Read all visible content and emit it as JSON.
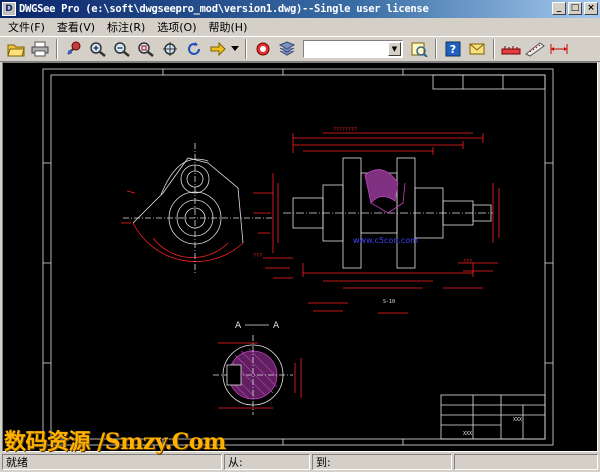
{
  "window": {
    "title": "DWGSee Pro (e:\\soft\\dwgseepro_mod\\version1.dwg)--Single user license",
    "icon_label": "D",
    "minimize": "_",
    "maximize": "□",
    "close": "×"
  },
  "menu": [
    "文件(F)",
    "查看(V)",
    "标注(R)",
    "选项(O)",
    "帮助(H)"
  ],
  "toolbar": {
    "icons": [
      "open-folder-icon",
      "print-icon",
      "pan-icon",
      "zoom-in-icon",
      "zoom-out-icon",
      "zoom-window-icon",
      "zoom-extents-icon",
      "rotate-icon",
      "arrow-forward-icon",
      "dropdown-icon",
      "layer-off-icon",
      "layers-icon",
      "open-icon",
      "help-icon",
      "email-icon",
      "measure-icon",
      "ruler-icon",
      "dimension-icon"
    ],
    "layer_select_value": ""
  },
  "drawing": {
    "section_label_left": "A",
    "section_label_right": "A",
    "watermark_url": "www.c5con.com",
    "title_block_text": "XXX",
    "label_s10": "S-10"
  },
  "status": {
    "ready": "就绪",
    "from_label": "从:",
    "to_label": "到:"
  },
  "overlay_watermark": "数码资源 /Smzy.Com",
  "colors": {
    "canvas": "#000000",
    "drawing_red": "#ff2020",
    "drawing_white": "#e0e0e0",
    "hatch_magenta": "#c040c0"
  }
}
